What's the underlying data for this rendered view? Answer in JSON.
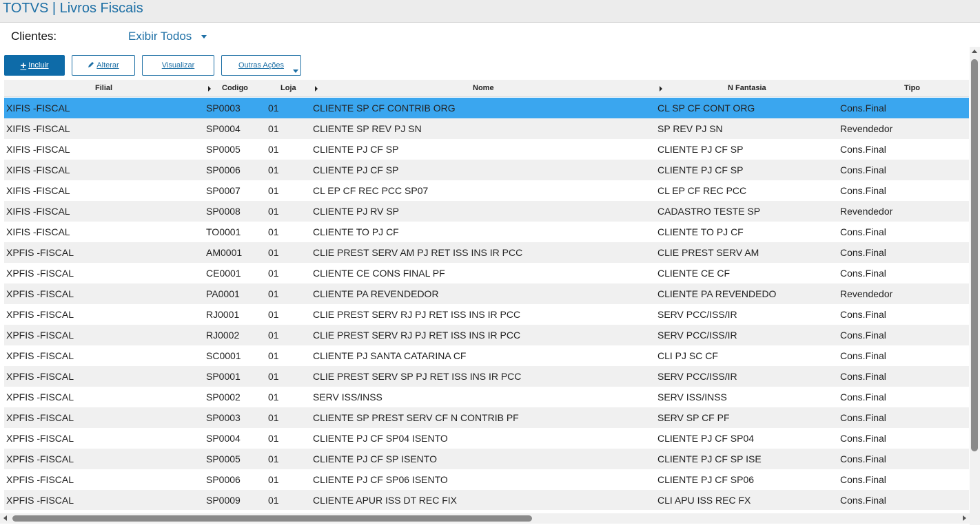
{
  "app": {
    "title": "TOTVS | Livros Fiscais"
  },
  "filter": {
    "label": "Clientes:",
    "value": "Exibir Todos"
  },
  "toolbar": {
    "incluir": "Incluir",
    "alterar": "Alterar",
    "visualizar": "Visualizar",
    "outras": "Outras Ações"
  },
  "columns": {
    "filial": "Filial",
    "codigo": "Codigo",
    "loja": "Loja",
    "nome": "Nome",
    "fantasia": "N Fantasia",
    "tipo": "Tipo"
  },
  "selected_row": 0,
  "colors": {
    "accent": "#1d6fa5",
    "primary_button": "#0e6ba8",
    "selected_row": "#3aa6ef",
    "alt_row": "#f0f0f0"
  },
  "rows": [
    {
      "filial": "XIFIS -FISCAL",
      "codigo": "SP0003",
      "loja": "01",
      "nome": "CLIENTE SP CF CONTRIB ORG",
      "fantasia": "CL SP CF CONT ORG",
      "tipo": "Cons.Final"
    },
    {
      "filial": "XIFIS -FISCAL",
      "codigo": "SP0004",
      "loja": "01",
      "nome": "CLIENTE SP REV PJ SN",
      "fantasia": "SP REV PJ SN",
      "tipo": "Revendedor"
    },
    {
      "filial": "XIFIS -FISCAL",
      "codigo": "SP0005",
      "loja": "01",
      "nome": "CLIENTE PJ CF SP",
      "fantasia": "CLIENTE PJ CF SP",
      "tipo": "Cons.Final"
    },
    {
      "filial": "XIFIS -FISCAL",
      "codigo": "SP0006",
      "loja": "01",
      "nome": "CLIENTE PJ CF SP",
      "fantasia": "CLIENTE PJ CF SP",
      "tipo": "Cons.Final"
    },
    {
      "filial": "XIFIS -FISCAL",
      "codigo": "SP0007",
      "loja": "01",
      "nome": "CL EP CF REC PCC SP07",
      "fantasia": "CL EP CF REC PCC",
      "tipo": "Cons.Final"
    },
    {
      "filial": "XIFIS -FISCAL",
      "codigo": "SP0008",
      "loja": "01",
      "nome": "CLIENTE PJ RV SP",
      "fantasia": "CADASTRO TESTE SP",
      "tipo": "Revendedor"
    },
    {
      "filial": "XIFIS -FISCAL",
      "codigo": "TO0001",
      "loja": "01",
      "nome": "CLIENTE TO PJ CF",
      "fantasia": "CLIENTE TO PJ CF",
      "tipo": "Cons.Final"
    },
    {
      "filial": "XPFIS -FISCAL",
      "codigo": "AM0001",
      "loja": "01",
      "nome": "CLIE PREST SERV AM PJ RET ISS INS IR PCC",
      "fantasia": "CLIE PREST SERV AM",
      "tipo": "Cons.Final"
    },
    {
      "filial": "XPFIS -FISCAL",
      "codigo": "CE0001",
      "loja": "01",
      "nome": "CLIENTE CE CONS FINAL PF",
      "fantasia": "CLIENTE CE CF",
      "tipo": "Cons.Final"
    },
    {
      "filial": "XPFIS -FISCAL",
      "codigo": "PA0001",
      "loja": "01",
      "nome": "CLIENTE PA REVENDEDOR",
      "fantasia": "CLIENTE PA REVENDEDO",
      "tipo": "Revendedor"
    },
    {
      "filial": "XPFIS -FISCAL",
      "codigo": "RJ0001",
      "loja": "01",
      "nome": "CLIE PREST SERV RJ PJ RET ISS INS IR PCC",
      "fantasia": "SERV PCC/ISS/IR",
      "tipo": "Cons.Final"
    },
    {
      "filial": "XPFIS -FISCAL",
      "codigo": "RJ0002",
      "loja": "01",
      "nome": "CLIE PREST SERV RJ PJ RET ISS INS IR PCC",
      "fantasia": "SERV PCC/ISS/IR",
      "tipo": "Cons.Final"
    },
    {
      "filial": "XPFIS -FISCAL",
      "codigo": "SC0001",
      "loja": "01",
      "nome": "CLIENTE PJ SANTA CATARINA CF",
      "fantasia": "CLI PJ SC CF",
      "tipo": "Cons.Final"
    },
    {
      "filial": "XPFIS -FISCAL",
      "codigo": "SP0001",
      "loja": "01",
      "nome": "CLIE PREST SERV SP PJ RET ISS INS IR PCC",
      "fantasia": "SERV PCC/ISS/IR",
      "tipo": "Cons.Final"
    },
    {
      "filial": "XPFIS -FISCAL",
      "codigo": "SP0002",
      "loja": "01",
      "nome": "SERV ISS/INSS",
      "fantasia": "SERV ISS/INSS",
      "tipo": "Cons.Final"
    },
    {
      "filial": "XPFIS -FISCAL",
      "codigo": "SP0003",
      "loja": "01",
      "nome": "CLIENTE SP PREST SERV CF N CONTRIB PF",
      "fantasia": "SERV SP CF PF",
      "tipo": "Cons.Final"
    },
    {
      "filial": "XPFIS -FISCAL",
      "codigo": "SP0004",
      "loja": "01",
      "nome": "CLIENTE PJ CF SP04 ISENTO",
      "fantasia": "CLIENTE PJ CF SP04",
      "tipo": "Cons.Final"
    },
    {
      "filial": "XPFIS -FISCAL",
      "codigo": "SP0005",
      "loja": "01",
      "nome": "CLIENTE PJ CF SP ISENTO",
      "fantasia": "CLIENTE PJ CF SP ISE",
      "tipo": "Cons.Final"
    },
    {
      "filial": "XPFIS -FISCAL",
      "codigo": "SP0006",
      "loja": "01",
      "nome": "CLIENTE PJ CF SP06 ISENTO",
      "fantasia": "CLIENTE PJ CF SP06",
      "tipo": "Cons.Final"
    },
    {
      "filial": "XPFIS -FISCAL",
      "codigo": "SP0009",
      "loja": "01",
      "nome": "CLIENTE APUR ISS DT REC FIX",
      "fantasia": "CLI APU ISS REC FX",
      "tipo": "Cons.Final"
    }
  ]
}
